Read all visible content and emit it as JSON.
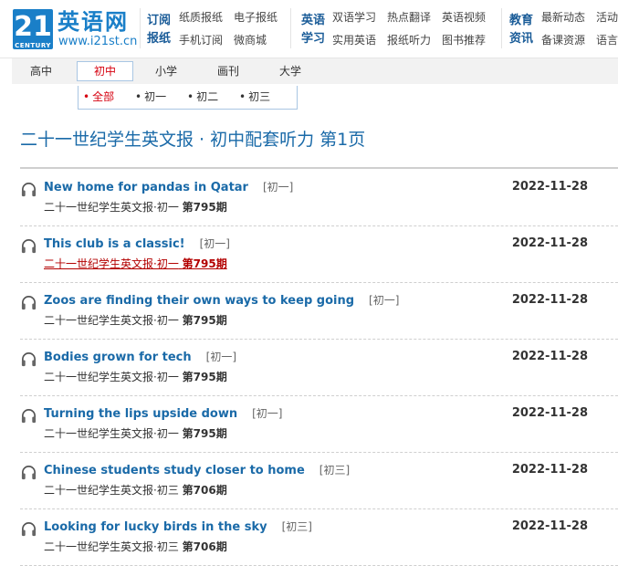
{
  "logo": {
    "mark": "21",
    "sub": "CENTURY",
    "cn": "英语网",
    "url": "www.i21st.cn"
  },
  "nav": [
    {
      "head": [
        "订阅",
        "报纸"
      ],
      "links": [
        [
          "纸质报纸",
          "电子报纸"
        ],
        [
          "手机订阅",
          "微商城"
        ]
      ]
    },
    {
      "head": [
        "英语",
        "学习"
      ],
      "links": [
        [
          "双语学习",
          "热点翻译",
          "英语视频"
        ],
        [
          "实用英语",
          "报纸听力",
          "图书推荐"
        ]
      ]
    },
    {
      "head": [
        "教育",
        "资讯"
      ],
      "links": [
        [
          "最新动态",
          "活动"
        ],
        [
          "备课资源",
          "语言"
        ]
      ]
    }
  ],
  "tabs": [
    "高中",
    "初中",
    "小学",
    "画刊",
    "大学"
  ],
  "active_tab": "初中",
  "subtabs": [
    "全部",
    "初一",
    "初二",
    "初三"
  ],
  "active_subtab": "全部",
  "page_title": "二十一世纪学生英文报 · 初中配套听力  第1页",
  "items": [
    {
      "title": "New home for pandas in Qatar",
      "grade": "[初一]",
      "date": "2022-11-28",
      "source": "二十一世纪学生英文报·初一",
      "issue": "第795期"
    },
    {
      "title": "This club is a classic!",
      "grade": "[初一]",
      "date": "2022-11-28",
      "source": "二十一世纪学生英文报·初一",
      "issue": "第795期",
      "hovered": true
    },
    {
      "title": "Zoos are finding their own ways to keep going",
      "grade": "[初一]",
      "date": "2022-11-28",
      "source": "二十一世纪学生英文报·初一",
      "issue": "第795期"
    },
    {
      "title": "Bodies grown for tech",
      "grade": "[初一]",
      "date": "2022-11-28",
      "source": "二十一世纪学生英文报·初一",
      "issue": "第795期"
    },
    {
      "title": "Turning the lips upside down",
      "grade": "[初一]",
      "date": "2022-11-28",
      "source": "二十一世纪学生英文报·初一",
      "issue": "第795期"
    },
    {
      "title": "Chinese students study closer to home",
      "grade": "[初三]",
      "date": "2022-11-28",
      "source": "二十一世纪学生英文报·初三",
      "issue": "第706期"
    },
    {
      "title": "Looking for lucky birds in the sky",
      "grade": "[初三]",
      "date": "2022-11-28",
      "source": "二十一世纪学生英文报·初三",
      "issue": "第706期"
    }
  ],
  "colors": {
    "brand": "#1a7fc8",
    "link": "#1a6aa8",
    "active": "#d6000f"
  },
  "icons": {
    "list_item": "headphones-icon"
  }
}
